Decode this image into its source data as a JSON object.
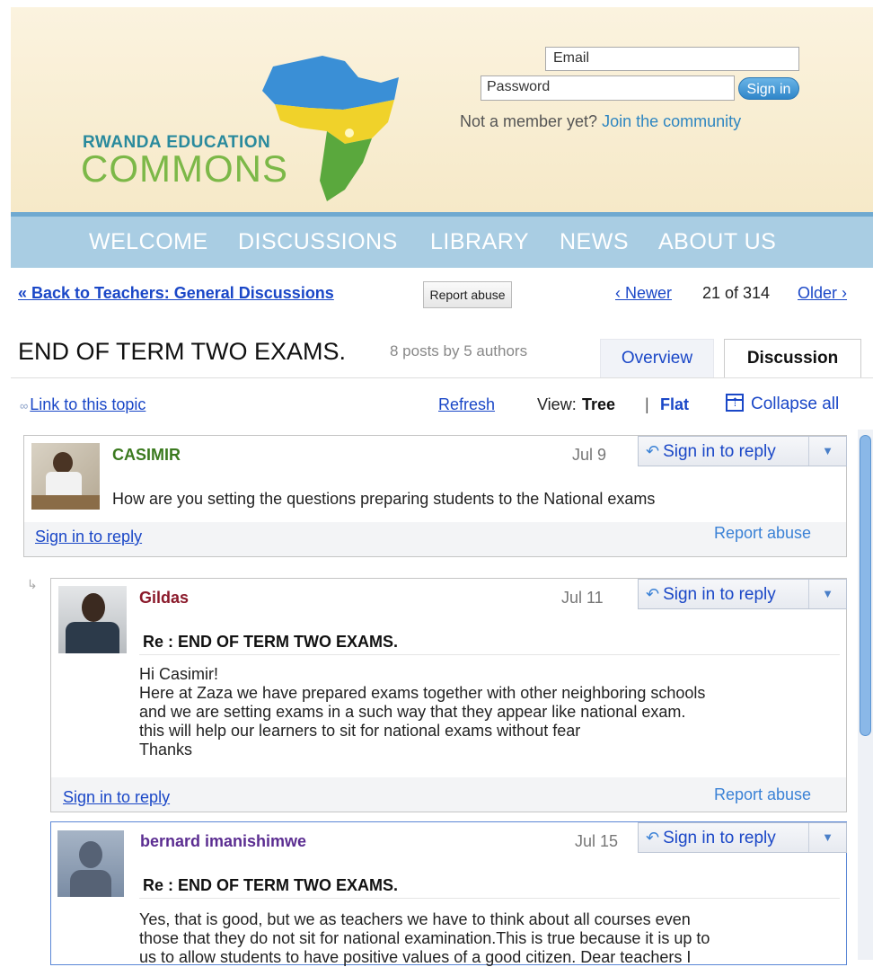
{
  "brand": {
    "line1": "RWANDA EDUCATION",
    "line2": "COMMONS"
  },
  "login": {
    "email_placeholder": "Email",
    "password_placeholder": "Password",
    "signin_label": "Sign in",
    "not_member_text": "Not a member yet?",
    "join_link": "Join the community"
  },
  "nav": {
    "items": [
      {
        "label": "WELCOME"
      },
      {
        "label": "DISCUSSIONS"
      },
      {
        "label": "LIBRARY"
      },
      {
        "label": "NEWS"
      },
      {
        "label": "ABOUT US"
      }
    ]
  },
  "topbar": {
    "back_link": "« Back to Teachers: General Discussions",
    "report_abuse": "Report abuse",
    "newer": "‹ Newer",
    "count": "21 of 314",
    "older": "Older ›"
  },
  "topic": {
    "title": "END OF TERM TWO EXAMS.",
    "meta": "8 posts by 5 authors",
    "tabs": [
      {
        "label": "Overview"
      },
      {
        "label": "Discussion"
      }
    ]
  },
  "toolbar": {
    "link_topic": "Link to this topic",
    "refresh": "Refresh",
    "view_label": "View:",
    "view_tree": "Tree",
    "view_sep": "|",
    "view_flat": "Flat",
    "collapse_all": "Collapse all"
  },
  "posts": [
    {
      "author": "CASIMIR",
      "author_color": "#3b7a1f",
      "date": "Jul 9",
      "reply_button": "Sign in to reply",
      "body": "How are you setting the questions preparing students to the National exams",
      "footer_reply": "Sign in to reply",
      "footer_report": "Report abuse"
    },
    {
      "author": "Gildas",
      "author_color": "#8b1a2b",
      "date": "Jul 11",
      "reply_button": "Sign in to reply",
      "subject": "Re : END OF TERM TWO EXAMS.",
      "body_lines": [
        "Hi Casimir!",
        "Here at Zaza we have prepared exams together with other neighboring schools",
        "and we are setting exams in a such way that they appear like national exam.",
        "this will help our learners to sit for national exams without fear",
        "Thanks"
      ],
      "footer_reply": "Sign in to reply",
      "footer_report": "Report abuse"
    },
    {
      "author": "bernard imanishimwe",
      "author_color": "#5b2d91",
      "date": "Jul 15",
      "reply_button": "Sign in to reply",
      "subject": "Re : END OF TERM TWO EXAMS.",
      "body_lines": [
        "Yes, that is good, but we as teachers we have to think about all courses even",
        "those that they do not sit for national examination.This is true because it is up to",
        "us to allow students to have positive values of a good citizen. Dear teachers I"
      ]
    }
  ]
}
